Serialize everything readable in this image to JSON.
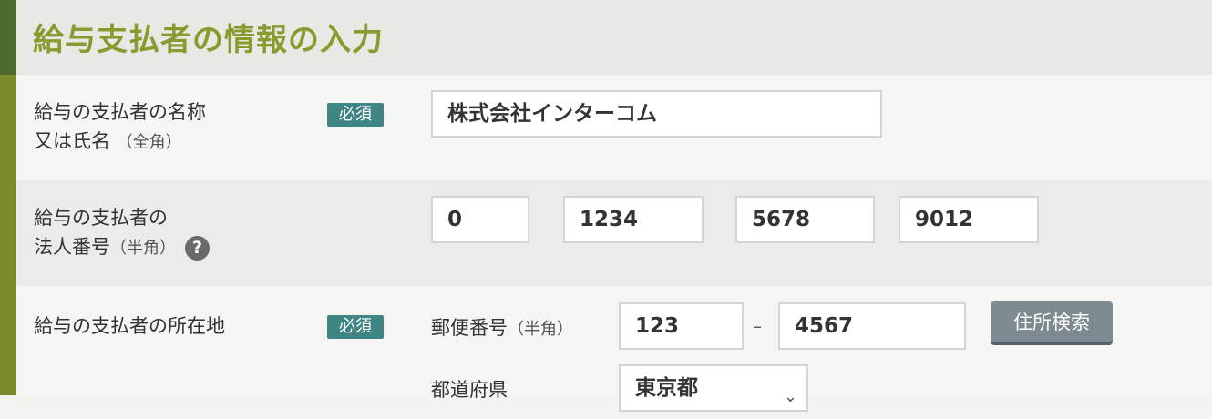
{
  "header": {
    "title": "給与支払者の情報の入力"
  },
  "rows": {
    "name": {
      "label_line1": "給与の支払者の名称",
      "label_line2": "又は氏名",
      "label_sub": "（全角）",
      "badge": "必須",
      "value": "株式会社インターコム"
    },
    "corp_number": {
      "label_line1": "給与の支払者の",
      "label_line2": "法人番号",
      "label_sub": "（半角）",
      "help_icon": "?",
      "values": [
        "0",
        "1234",
        "5678",
        "9012"
      ]
    },
    "address": {
      "label": "給与の支払者の所在地",
      "badge": "必須",
      "postal_label": "郵便番号",
      "postal_sub": "（半角）",
      "postal_1": "123",
      "postal_dash": "–",
      "postal_2": "4567",
      "search_button": "住所検索",
      "prefecture_label": "都道府県",
      "prefecture_value": "東京都"
    }
  },
  "icons": {
    "help": "question-circle-icon",
    "dropdown": "chevron-down-icon"
  },
  "colors": {
    "title": "#8a9a2e",
    "badge": "#3f8583",
    "leftbar": "#7c8a2a",
    "button": "#7d8b91"
  }
}
